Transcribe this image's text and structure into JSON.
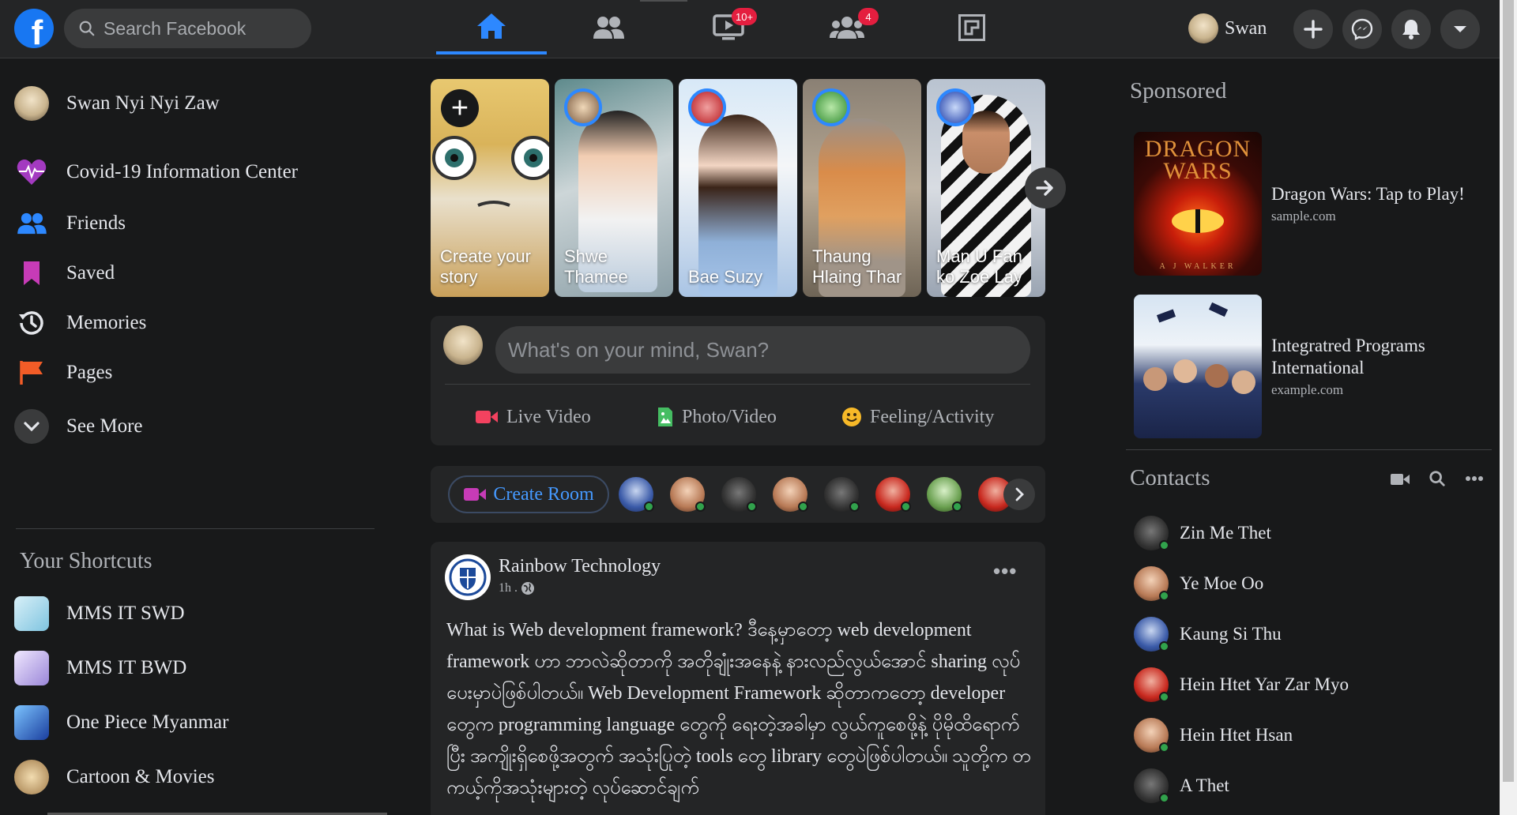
{
  "header": {
    "logo": "f",
    "search_placeholder": "Search Facebook",
    "tabs": [
      {
        "name": "home",
        "badge": ""
      },
      {
        "name": "friends",
        "badge": ""
      },
      {
        "name": "watch",
        "badge": "10+"
      },
      {
        "name": "groups",
        "badge": "4"
      },
      {
        "name": "gaming",
        "badge": ""
      }
    ],
    "profile_name": "Swan",
    "actions": [
      "plus-icon",
      "messenger-icon",
      "bell-icon",
      "caret-down-icon"
    ]
  },
  "sidebar": {
    "items": [
      {
        "label": "Swan Nyi Nyi Zaw",
        "icon": "avatar"
      },
      {
        "label": "Covid-19 Information Center",
        "icon": "heart-pulse-icon"
      },
      {
        "label": "Friends",
        "icon": "friends-icon"
      },
      {
        "label": "Saved",
        "icon": "bookmark-icon"
      },
      {
        "label": "Memories",
        "icon": "clock-history-icon"
      },
      {
        "label": "Pages",
        "icon": "flag-icon"
      },
      {
        "label": "See More",
        "icon": "chevron-down-icon"
      }
    ],
    "shortcuts_title": "Your Shortcuts",
    "shortcuts": [
      {
        "label": "MMS IT SWD"
      },
      {
        "label": "MMS IT BWD"
      },
      {
        "label": "One Piece Myanmar"
      },
      {
        "label": "Cartoon & Movies"
      }
    ]
  },
  "stories": [
    {
      "name": "Create your story"
    },
    {
      "name": "Shwe Thamee"
    },
    {
      "name": "Bae Suzy"
    },
    {
      "name": "Thaung Hlaing Thar"
    },
    {
      "name": "Man U Fan ko Zoe Lay"
    }
  ],
  "composer": {
    "placeholder": "What's on your mind, Swan?",
    "actions": [
      {
        "label": "Live Video",
        "color": "#f3425f"
      },
      {
        "label": "Photo/Video",
        "color": "#45bd62"
      },
      {
        "label": "Feeling/Activity",
        "color": "#f7b928"
      }
    ]
  },
  "rooms": {
    "create_label": "Create Room"
  },
  "post": {
    "author": "Rainbow Technology",
    "time": "1h .",
    "more": "•••",
    "text": "What is Web development framework? ဒီနေ့မှာတော့ web development framework ဟာ ဘာလဲဆိုတာကို အတိုချုံးအနေနဲ့ နားလည်လွယ်အောင် sharing လုပ်ပေးမှာပဲဖြစ်ပါတယ်။ Web Development Framework ဆိုတာကတော့ developer တွေက programming language တွေကို ရေးတဲ့အခါမှာ လွယ်ကူစေဖို့နဲ့ ပိုမိုထိရောက်ပြီး အကျိုးရှိစေဖို့အတွက် အသုံးပြုတဲ့ tools တွေ library တွေပဲဖြစ်ပါတယ်။ သူတို့က တကယ့်ကိုအသုံးများတဲ့ လုပ်ဆောင်ချက်"
  },
  "right": {
    "sponsored_title": "Sponsored",
    "ads": [
      {
        "title": "Dragon Wars: Tap to Play!",
        "url": "sample.com",
        "thumb_text": "DRAGON WARS",
        "thumb_sub": "A J WALKER"
      },
      {
        "title": "Integratred Programs International",
        "url": "example.com"
      }
    ],
    "contacts_title": "Contacts",
    "contacts": [
      {
        "name": "Zin Me Thet"
      },
      {
        "name": "Ye Moe Oo"
      },
      {
        "name": "Kaung Si Thu"
      },
      {
        "name": "Hein Htet Yar Zar Myo"
      },
      {
        "name": "Hein Htet Hsan"
      },
      {
        "name": "A Thet"
      }
    ]
  },
  "colors": {
    "background": "#18191a",
    "surface": "#242526",
    "accent": "#2d88ff",
    "badge": "#e41e3f",
    "online": "#31a24c"
  }
}
